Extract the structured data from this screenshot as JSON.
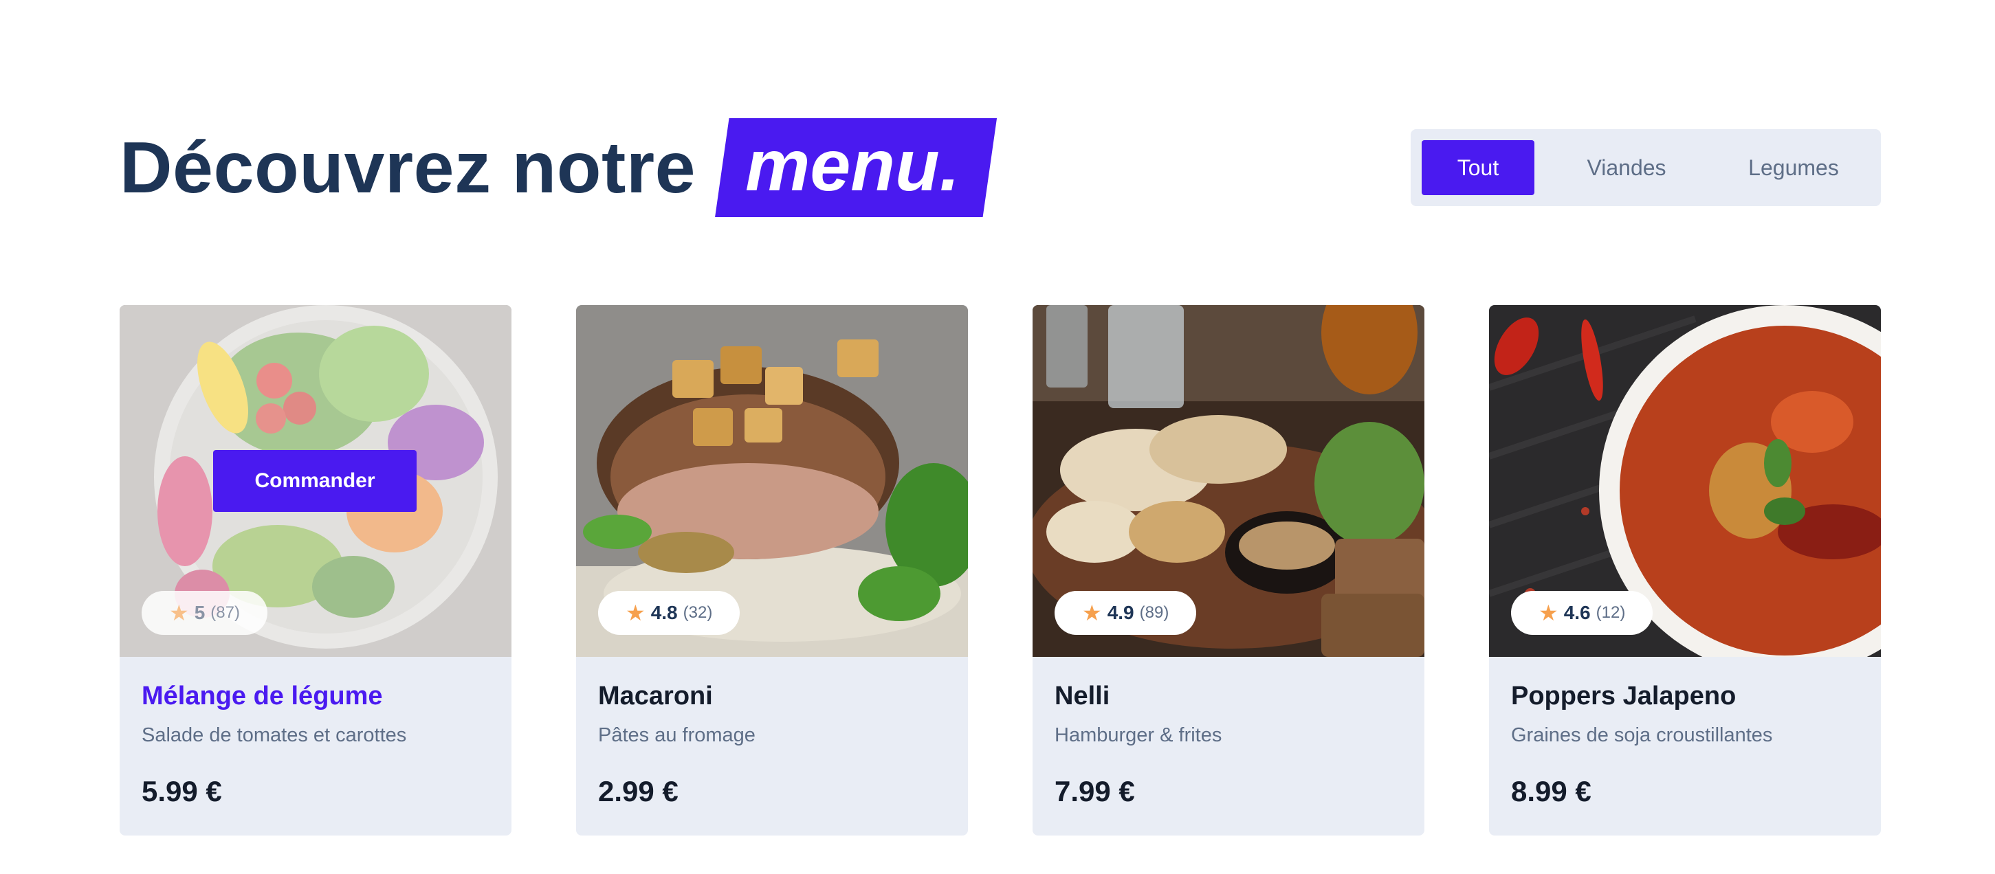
{
  "header": {
    "title": "Découvrez notre",
    "highlight": "menu."
  },
  "filters": [
    {
      "label": "Tout",
      "active": true
    },
    {
      "label": "Viandes",
      "active": false
    },
    {
      "label": "Legumes",
      "active": false
    }
  ],
  "cards": [
    {
      "name": "Mélange de légume",
      "description": "Salade de tomates et carottes",
      "price": "5.99 €",
      "rating": "5",
      "reviews": "(87)",
      "image_icon": "salad-photo",
      "hovered": true,
      "order_label": "Commander"
    },
    {
      "name": "Macaroni",
      "description": "Pâtes au fromage",
      "price": "2.99 €",
      "rating": "4.8",
      "reviews": "(32)",
      "image_icon": "grilled-meat-photo",
      "hovered": false
    },
    {
      "name": "Nelli",
      "description": "Hamburger & frites",
      "price": "7.99 €",
      "rating": "4.9",
      "reviews": "(89)",
      "image_icon": "seafood-platter-photo",
      "hovered": false
    },
    {
      "name": "Poppers Jalapeno",
      "description": "Graines de soja croustillantes",
      "price": "8.99 €",
      "rating": "4.6",
      "reviews": "(12)",
      "image_icon": "curry-bowl-photo",
      "hovered": false
    }
  ],
  "colors": {
    "accent": "#4a1af0",
    "title": "#1e3556",
    "card_bg": "#e9edf5",
    "star": "#f6a04d"
  }
}
